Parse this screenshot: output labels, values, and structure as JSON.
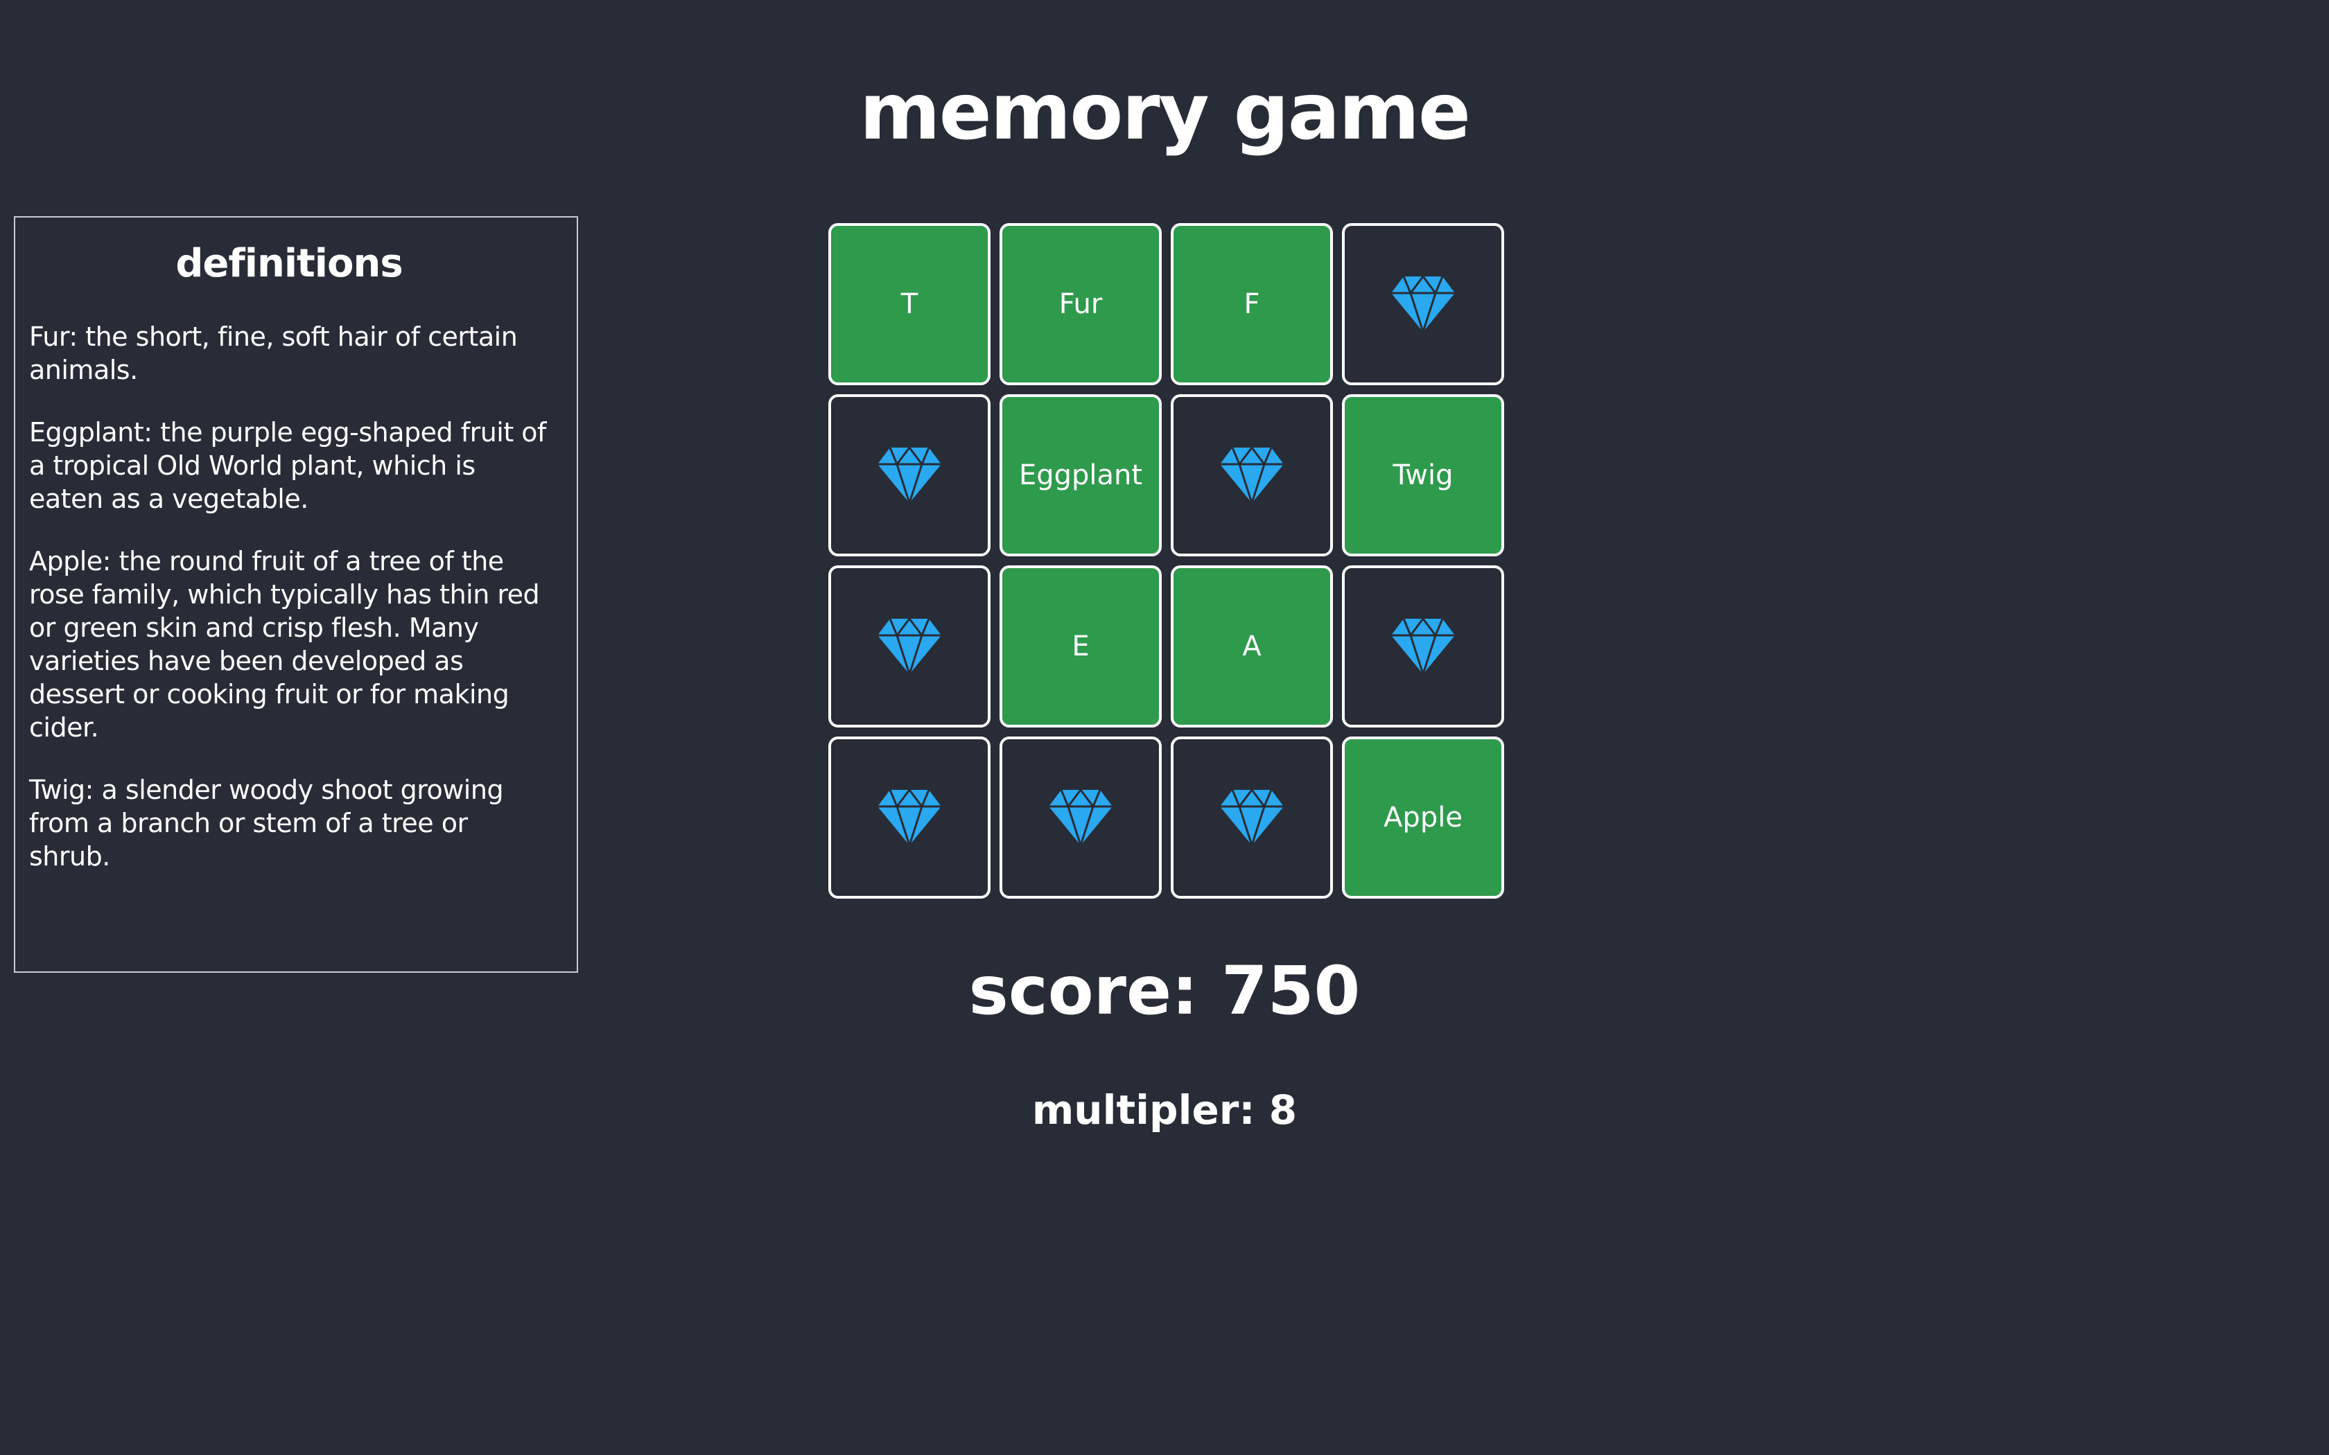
{
  "title": "memory game",
  "colors": {
    "background": "#272c36",
    "card_revealed": "#2e9a4c",
    "card_border": "#ffffff",
    "gem": "#2aa8f0"
  },
  "definitions": {
    "title": "definitions",
    "items": [
      "Fur: the short, fine, soft hair of certain animals.",
      "Eggplant: the purple egg-shaped fruit of a tropical Old World plant, which is eaten as a vegetable.",
      "Apple: the round fruit of a tree of the rose family, which typically has thin red or green skin and crisp flesh. Many varieties have been developed as dessert or cooking fruit or for making cider.",
      "Twig: a slender woody shoot growing from a branch or stem of a tree or shrub."
    ]
  },
  "board": {
    "cards": [
      {
        "state": "revealed",
        "label": "T"
      },
      {
        "state": "revealed",
        "label": "Fur"
      },
      {
        "state": "revealed",
        "label": "F"
      },
      {
        "state": "hidden",
        "icon": "diamond-icon"
      },
      {
        "state": "hidden",
        "icon": "diamond-icon"
      },
      {
        "state": "revealed",
        "label": "Eggplant"
      },
      {
        "state": "hidden",
        "icon": "diamond-icon"
      },
      {
        "state": "revealed",
        "label": "Twig"
      },
      {
        "state": "hidden",
        "icon": "diamond-icon"
      },
      {
        "state": "revealed",
        "label": "E"
      },
      {
        "state": "revealed",
        "label": "A"
      },
      {
        "state": "hidden",
        "icon": "diamond-icon"
      },
      {
        "state": "hidden",
        "icon": "diamond-icon"
      },
      {
        "state": "hidden",
        "icon": "diamond-icon"
      },
      {
        "state": "hidden",
        "icon": "diamond-icon"
      },
      {
        "state": "revealed",
        "label": "Apple"
      }
    ]
  },
  "score": "score: 750",
  "multiplier": "multipler: 8"
}
